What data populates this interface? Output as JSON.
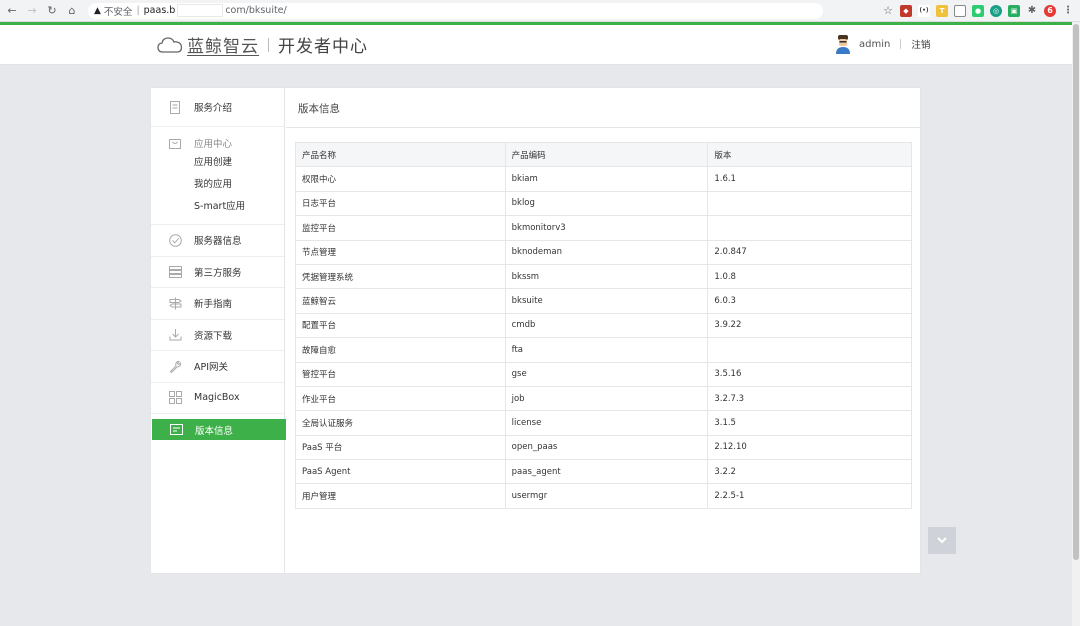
{
  "browser": {
    "security_label": "不安全",
    "url_host_prefix": "paas.b",
    "url_host_suffix": "com/bksuite/"
  },
  "header": {
    "brand": "蓝鲸智云",
    "subtitle": "开发者中心",
    "username": "admin",
    "logout_label": "注销"
  },
  "sidebar": {
    "items": [
      {
        "label": "服务介绍",
        "icon": "document-icon"
      },
      {
        "label": "服务器信息",
        "icon": "check-circle-icon"
      },
      {
        "label": "第三方服务",
        "icon": "server-icon"
      },
      {
        "label": "新手指南",
        "icon": "signpost-icon"
      },
      {
        "label": "资源下载",
        "icon": "download-icon"
      },
      {
        "label": "API网关",
        "icon": "wrench-icon"
      },
      {
        "label": "MagicBox",
        "icon": "grid-icon"
      }
    ],
    "app_center": {
      "label": "应用中心",
      "subitems": [
        "应用创建",
        "我的应用",
        "S-mart应用"
      ]
    },
    "active": {
      "label": "版本信息",
      "icon": "version-icon"
    }
  },
  "content": {
    "title": "版本信息",
    "columns": [
      "产品名称",
      "产品编码",
      "版本"
    ],
    "rows": [
      [
        "权限中心",
        "bkiam",
        "1.6.1"
      ],
      [
        "日志平台",
        "bklog",
        ""
      ],
      [
        "监控平台",
        "bkmonitorv3",
        ""
      ],
      [
        "节点管理",
        "bknodeman",
        "2.0.847"
      ],
      [
        "凭据管理系统",
        "bkssm",
        "1.0.8"
      ],
      [
        "蓝鲸智云",
        "bksuite",
        "6.0.3"
      ],
      [
        "配置平台",
        "cmdb",
        "3.9.22"
      ],
      [
        "故障自愈",
        "fta",
        ""
      ],
      [
        "管控平台",
        "gse",
        "3.5.16"
      ],
      [
        "作业平台",
        "job",
        "3.2.7.3"
      ],
      [
        "全局认证服务",
        "license",
        "3.1.5"
      ],
      [
        "PaaS 平台",
        "open_paas",
        "2.12.10"
      ],
      [
        "PaaS Agent",
        "paas_agent",
        "3.2.2"
      ],
      [
        "用户管理",
        "usermgr",
        "2.2.5-1"
      ]
    ]
  },
  "colors": {
    "accent": "#3eb04a",
    "background": "#e7e8ec"
  }
}
